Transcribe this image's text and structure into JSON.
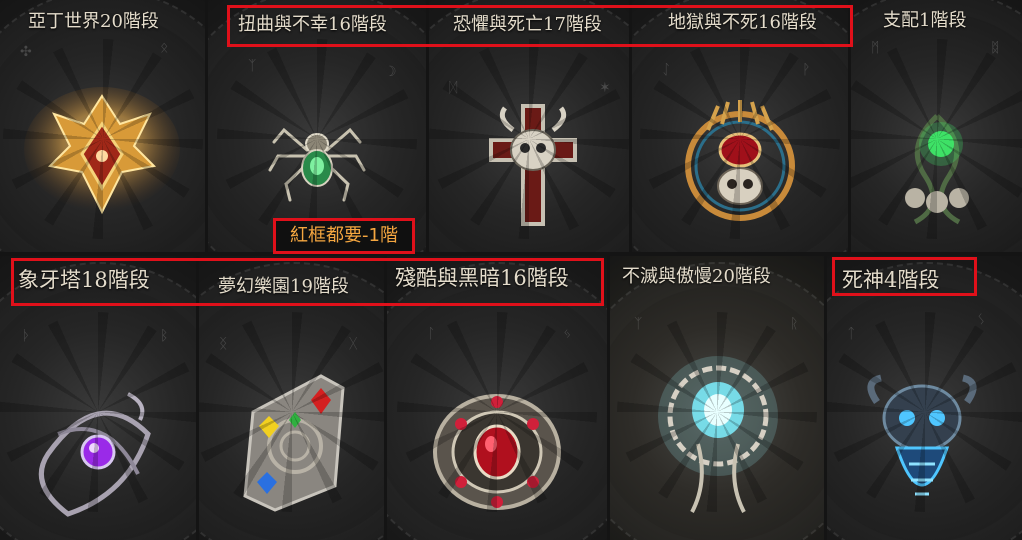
{
  "aspects": {
    "1": "亞丁世界20階段",
    "2": "扭曲與不幸16階段",
    "3": "恐懼與死亡17階段",
    "4": "地獄與不死16階段",
    "5": "支配1階段",
    "6": "象牙塔18階段",
    "7": "夢幻樂園19階段",
    "8": "殘酷與黑暗16階段",
    "9": "不滅與傲慢20階段",
    "10": "死神4階段"
  },
  "note": "紅框都要-1階",
  "colors": {
    "highlight_frame": "#e0101a",
    "note_text": "#f4a640",
    "label_text": "#e4dccb"
  },
  "charms": [
    {
      "name": "golden-flame-charm-icon"
    },
    {
      "name": "spider-charm-icon"
    },
    {
      "name": "skull-cross-charm-icon"
    },
    {
      "name": "horned-skull-charm-icon"
    },
    {
      "name": "green-skull-vine-charm-icon"
    },
    {
      "name": "purple-gem-knot-charm-icon"
    },
    {
      "name": "jeweled-tablet-charm-icon"
    },
    {
      "name": "ruby-ornate-charm-icon"
    },
    {
      "name": "spectral-ring-charm-icon"
    },
    {
      "name": "blue-reaper-skull-charm-icon"
    }
  ]
}
